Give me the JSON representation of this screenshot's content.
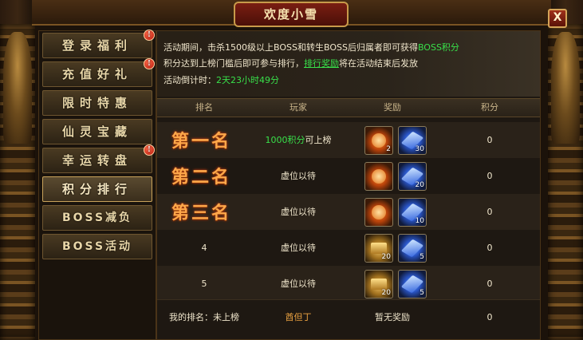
{
  "window": {
    "title": "欢度小雪",
    "close_label": "X"
  },
  "sidebar": {
    "items": [
      {
        "label": "登录福利",
        "badge": "!",
        "active": false
      },
      {
        "label": "充值好礼",
        "badge": "!",
        "active": false
      },
      {
        "label": "限时特惠",
        "badge": "",
        "active": false
      },
      {
        "label": "仙灵宝藏",
        "badge": "",
        "active": false
      },
      {
        "label": "幸运转盘",
        "badge": "!",
        "active": false
      },
      {
        "label": "积分排行",
        "badge": "",
        "active": true
      },
      {
        "label": "BOSS减负",
        "badge": "",
        "active": false
      },
      {
        "label": "BOSS活动",
        "badge": "",
        "active": false
      }
    ]
  },
  "info": {
    "line1_prefix": "活动期间，击杀1500级以上BOSS和转生BOSS后归属者即可获得",
    "line1_highlight": "BOSS积分",
    "line2_prefix": "积分达到上榜门槛后即可参与排行，",
    "line2_highlight": "排行奖励",
    "line2_suffix": "将在活动结束后发放",
    "line3_label": "活动倒计时：",
    "line3_value": "2天23小时49分"
  },
  "table": {
    "headers": {
      "rank": "排名",
      "player": "玩家",
      "reward": "奖励",
      "score": "积分"
    },
    "rows": [
      {
        "rank": "第一名",
        "player_highlight": "1000积分",
        "player_suffix": "可上榜",
        "reward1_icon": "fire-orb-icon",
        "reward1_count": "2",
        "reward2_icon": "blue-crystal-icon",
        "reward2_count": "30",
        "score": "0"
      },
      {
        "rank": "第二名",
        "player_highlight": "",
        "player_suffix": "虚位以待",
        "reward1_icon": "fire-orb-icon",
        "reward1_count": "",
        "reward2_icon": "blue-crystal-icon",
        "reward2_count": "20",
        "score": "0"
      },
      {
        "rank": "第三名",
        "player_highlight": "",
        "player_suffix": "虚位以待",
        "reward1_icon": "fire-orb-icon",
        "reward1_count": "",
        "reward2_icon": "blue-crystal-icon",
        "reward2_count": "10",
        "score": "0"
      },
      {
        "rank": "4",
        "player_highlight": "",
        "player_suffix": "虚位以待",
        "reward1_icon": "gold-chest-icon",
        "reward1_count": "20",
        "reward2_icon": "blue-crystal-icon",
        "reward2_count": "5",
        "score": "0"
      },
      {
        "rank": "5",
        "player_highlight": "",
        "player_suffix": "虚位以待",
        "reward1_icon": "gold-chest-icon",
        "reward1_count": "20",
        "reward2_icon": "blue-crystal-icon",
        "reward2_count": "5",
        "score": "0"
      }
    ]
  },
  "my_rank": {
    "label": "我的排名：未上榜",
    "player": "酋但丁",
    "reward": "暂无奖励",
    "score": "0"
  }
}
